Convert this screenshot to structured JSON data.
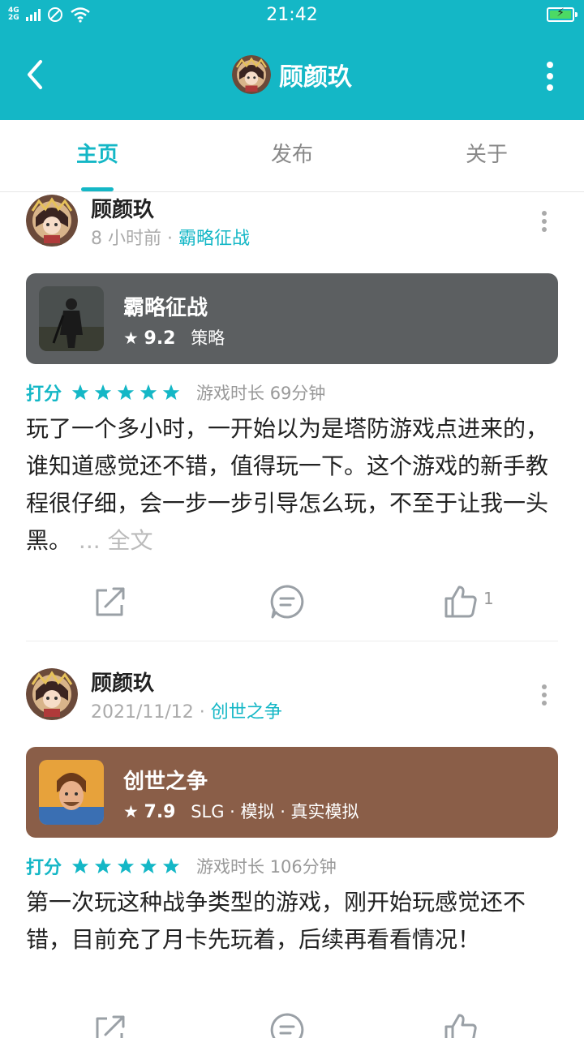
{
  "status_bar": {
    "network": "4G",
    "network2": "2G",
    "time": "21:42"
  },
  "header": {
    "title": "顾颜玖"
  },
  "tabs": [
    {
      "label": "主页",
      "active": true
    },
    {
      "label": "发布",
      "active": false
    },
    {
      "label": "关于",
      "active": false
    }
  ],
  "posts": [
    {
      "username": "顾颜玖",
      "time": "8 小时前",
      "separator": " · ",
      "game_link": "霸略征战",
      "game": {
        "name": "霸略征战",
        "score": "9.2",
        "tags": "策略",
        "card_color": "#5c5f61"
      },
      "rating_label": "打分",
      "stars": 5,
      "playtime": "游戏时长 69分钟",
      "text": "玩了一个多小时，一开始以为是塔防游戏点进来的，谁知道感觉还不错，值得玩一下。这个游戏的新手教程很仔细，会一步一步引导怎么玩，不至于让我一头黑。",
      "more": " ... 全文",
      "likes": "1"
    },
    {
      "username": "顾颜玖",
      "time": "2021/11/12",
      "separator": " · ",
      "game_link": "创世之争",
      "game": {
        "name": "创世之争",
        "score": "7.9",
        "tags": "SLG · 模拟 · 真实模拟",
        "card_color": "#8a5e48"
      },
      "rating_label": "打分",
      "stars": 5,
      "playtime": "游戏时长 106分钟",
      "text": "第一次玩这种战争类型的游戏，刚开始玩感觉还不错，目前充了月卡先玩着，后续再看看情况！"
    }
  ],
  "colors": {
    "accent": "#14b7c6",
    "star": "#14b7c6"
  }
}
